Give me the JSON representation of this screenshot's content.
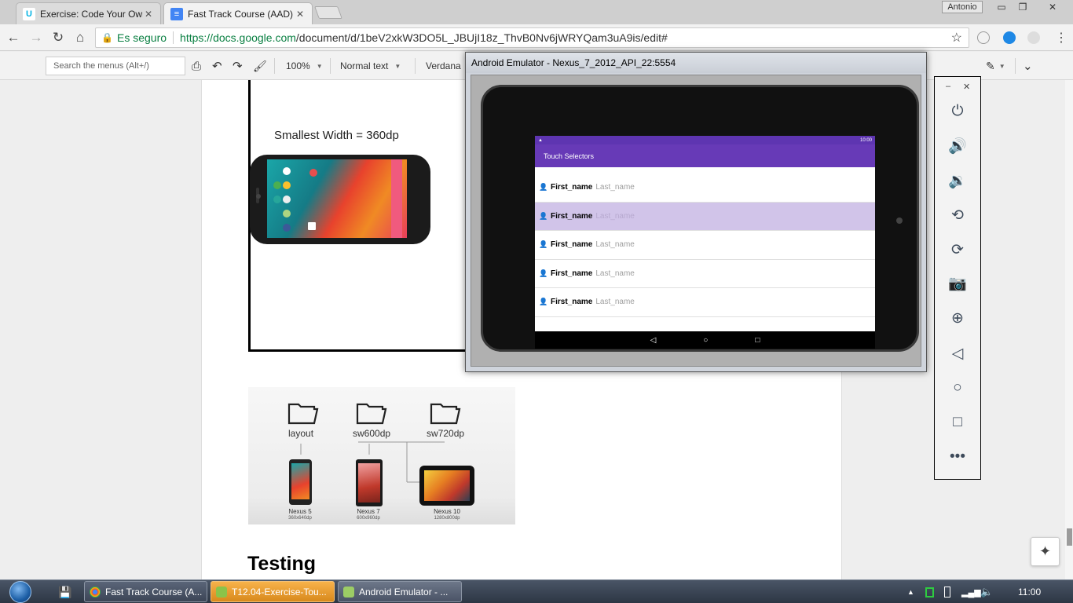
{
  "browser": {
    "tabs": [
      {
        "title": "Exercise: Code Your Own",
        "favicon": "udacity-icon",
        "active": false
      },
      {
        "title": "Fast Track Course (AAD)",
        "favicon": "docs-icon",
        "active": true
      }
    ],
    "user": "Antonio",
    "address": {
      "secure_label": "Es seguro",
      "url_host": "https://docs.google.com",
      "url_path": "/document/d/1beV2xkW3DO5L_JBUjI18z_ThvB0Nv6jWRYQam3uA9is/edit#"
    }
  },
  "docs_toolbar": {
    "search_placeholder": "Search the menus (Alt+/)",
    "zoom": "100%",
    "style": "Normal text",
    "font": "Verdana"
  },
  "document": {
    "figure1_label": "Smallest Width = 360dp",
    "folders": [
      {
        "name": "layout"
      },
      {
        "name": "sw600dp"
      },
      {
        "name": "sw720dp"
      }
    ],
    "devices": [
      {
        "name": "Nexus 5",
        "res": "360x640dp"
      },
      {
        "name": "Nexus 7",
        "res": "600x960dp"
      },
      {
        "name": "Nexus 10",
        "res": "1280x800dp"
      }
    ],
    "heading": "Testing"
  },
  "emulator": {
    "title": "Android Emulator - Nexus_7_2012_API_22:5554",
    "status_time": "10:00",
    "app_title": "Touch Selectors",
    "rows": [
      {
        "first": "First_name",
        "last": "Last_name",
        "selected": false
      },
      {
        "first": "First_name",
        "last": "Last_name",
        "selected": true
      },
      {
        "first": "First_name",
        "last": "Last_name",
        "selected": false
      },
      {
        "first": "First_name",
        "last": "Last_name",
        "selected": false
      },
      {
        "first": "First_name",
        "last": "Last_name",
        "selected": false
      }
    ],
    "accent": "#673ab7",
    "selected_color": "#d1c4e9"
  },
  "emulator_panel": {
    "buttons": [
      "power-icon",
      "volume-up-icon",
      "volume-down-icon",
      "rotate-left-icon",
      "rotate-right-icon",
      "camera-icon",
      "zoom-icon",
      "back-icon",
      "home-icon",
      "overview-icon",
      "more-icon"
    ]
  },
  "taskbar": {
    "tasks": [
      {
        "label": "Fast Track Course (A..."
      },
      {
        "label": "T12.04-Exercise-Tou..."
      },
      {
        "label": "Android Emulator - ..."
      }
    ],
    "clock": "11:00"
  }
}
